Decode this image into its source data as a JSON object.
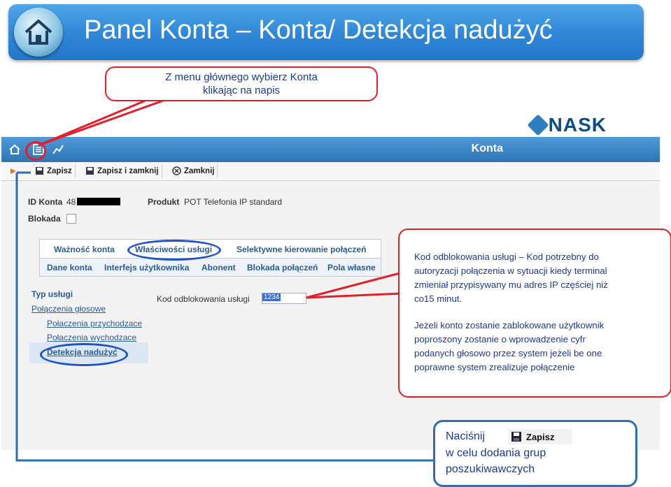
{
  "slide": {
    "title": "Panel Konta – Konta/ Detekcja nadużyć"
  },
  "app": {
    "logo_text": "NASK",
    "nav_title": "Konta",
    "toolbar": {
      "save": "Zapisz",
      "save_close": "Zapisz i zamknij",
      "close": "Zamknij"
    },
    "fields": {
      "id_label": "ID Konta",
      "id_value": "48",
      "product_label": "Produkt",
      "product_value": "POT Telefonia IP standard",
      "block_label": "Blokada"
    },
    "tabs_row1": [
      "Ważność konta",
      "Właściwości usługi",
      "Selektywne kierowanie połączeń"
    ],
    "tabs_row2": [
      "Dane konta",
      "Interfejs użytkownika",
      "Abonent",
      "Blokada połączeń",
      "Pola własne"
    ],
    "sidebar": {
      "heading": "Typ usługi",
      "items": [
        "Połączenia głosowe",
        "Połaczenia przychodzace",
        "Połaczenia wychodzace",
        "Detekcja nadużyć"
      ]
    },
    "unlock_label": "Kod odblokowania usługi",
    "unlock_value": "1234"
  },
  "callouts": {
    "menu": [
      "Z menu głównego wybierz Konta",
      "klikając na napis"
    ],
    "unlock": [
      "Kod odblokowania usługi – Kod potrzebny do",
      "autoryzacji połączenia w sytuacji kiedy terminal",
      "zmieniał przypisywany mu adres IP częściej niż",
      "co15 minut.",
      "Jeżeli konto zostanie zablokowane użytkownik",
      "poproszony zostanie o wprowadzenie cyfr",
      "podanych głosowo przez system jeżeli be one",
      "poprawne system zrealizuje połączenie"
    ],
    "save": {
      "line1": "Naciśnij",
      "button": "Zapisz",
      "line2": "w celu dodania grup",
      "line3": "poszukiwawczych"
    }
  },
  "colors": {
    "title_bar": "#2f86d6",
    "callout_red": "#e0202a",
    "callout_blue": "#2d6db3",
    "text_blue": "#1b3a8f",
    "nav_blue": "#2f74b6"
  }
}
